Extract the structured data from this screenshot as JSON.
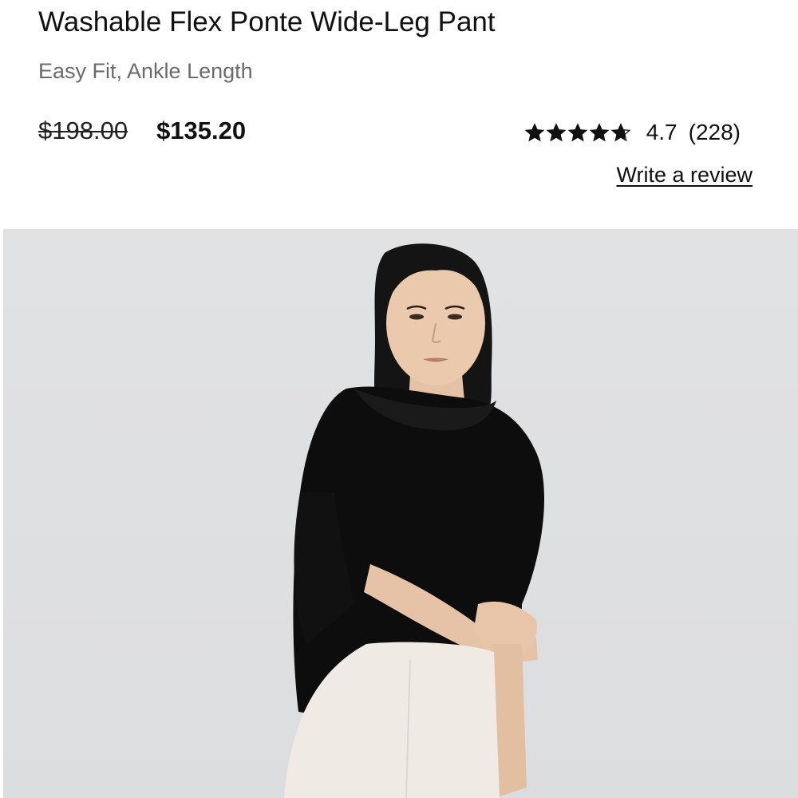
{
  "product": {
    "title": "Washable Flex Ponte Wide-Leg Pant",
    "subtitle": "Easy Fit, Ankle Length",
    "price_original": "$198.00",
    "price_sale": "$135.20"
  },
  "rating": {
    "value": "4.7",
    "count": "(228)",
    "stars_max": 5,
    "stars_value": 4.7,
    "star_icon": "star-icon"
  },
  "review": {
    "link_label": "Write a review"
  },
  "image": {
    "icon": "product-photo",
    "background_color": "#dfe0e2"
  },
  "colors": {
    "text": "#111111",
    "muted": "#6b6b6b"
  }
}
